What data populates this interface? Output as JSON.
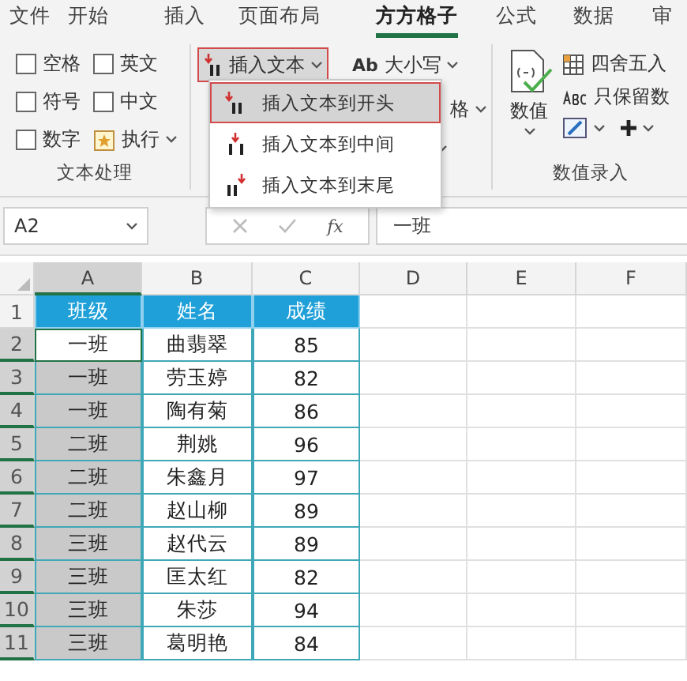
{
  "ribbon_tabs": [
    {
      "label": "文件",
      "selected": false
    },
    {
      "label": "开始",
      "selected": false
    },
    {
      "label": "插入",
      "selected": false
    },
    {
      "label": "页面布局",
      "selected": false
    },
    {
      "label": "方方格子",
      "selected": true
    },
    {
      "label": "公式",
      "selected": false
    },
    {
      "label": "数据",
      "selected": false
    },
    {
      "label": "审",
      "selected": false
    }
  ],
  "text_group": {
    "checkboxes": [
      {
        "label": "空格",
        "checked": false
      },
      {
        "label": "英文",
        "checked": false
      },
      {
        "label": "符号",
        "checked": false
      },
      {
        "label": "中文",
        "checked": false
      },
      {
        "label": "数字",
        "checked": false
      }
    ],
    "execute_button": "执行",
    "label": "文本处理"
  },
  "insert_group": {
    "insert_text_button": {
      "label": "插入文本",
      "expanded": true
    },
    "case_button": {
      "icon_text": "Ab",
      "label": "大小写"
    },
    "partial_button": "格"
  },
  "number_group": {
    "number_button": "数值",
    "round_button": "四舍五入",
    "keep_button": "只保留数",
    "label": "数值录入"
  },
  "insert_menu": {
    "items": [
      {
        "label": "插入文本到开头",
        "selected": true
      },
      {
        "label": "插入文本到中间",
        "selected": false
      },
      {
        "label": "插入文本到末尾",
        "selected": false
      }
    ]
  },
  "formula_bar": {
    "name_box": "A2",
    "fx": "fx",
    "value": "一班"
  },
  "sheet": {
    "columns": [
      {
        "label": "A",
        "selected": true
      },
      {
        "label": "B",
        "selected": false
      },
      {
        "label": "C",
        "selected": false
      },
      {
        "label": "D",
        "selected": false
      },
      {
        "label": "E",
        "selected": false
      },
      {
        "label": "F",
        "selected": false
      }
    ],
    "rows": [
      {
        "number": "1",
        "kind": "header",
        "selected": false,
        "active": false,
        "cells": [
          "班级",
          "姓名",
          "成绩"
        ]
      },
      {
        "number": "2",
        "kind": "data",
        "selected": true,
        "active": true,
        "cells": [
          "一班",
          "曲翡翠",
          "85"
        ]
      },
      {
        "number": "3",
        "kind": "data",
        "selected": true,
        "active": false,
        "cells": [
          "一班",
          "劳玉婷",
          "82"
        ]
      },
      {
        "number": "4",
        "kind": "data",
        "selected": true,
        "active": false,
        "cells": [
          "一班",
          "陶有菊",
          "86"
        ]
      },
      {
        "number": "5",
        "kind": "data",
        "selected": true,
        "active": false,
        "cells": [
          "二班",
          "荆姚",
          "96"
        ]
      },
      {
        "number": "6",
        "kind": "data",
        "selected": true,
        "active": false,
        "cells": [
          "二班",
          "朱鑫月",
          "97"
        ]
      },
      {
        "number": "7",
        "kind": "data",
        "selected": true,
        "active": false,
        "cells": [
          "二班",
          "赵山柳",
          "89"
        ]
      },
      {
        "number": "8",
        "kind": "data",
        "selected": true,
        "active": false,
        "cells": [
          "三班",
          "赵代云",
          "89"
        ]
      },
      {
        "number": "9",
        "kind": "data",
        "selected": true,
        "active": false,
        "cells": [
          "三班",
          "匡太红",
          "82"
        ]
      },
      {
        "number": "10",
        "kind": "data",
        "selected": true,
        "active": false,
        "cells": [
          "三班",
          "朱莎",
          "94"
        ]
      },
      {
        "number": "11",
        "kind": "data",
        "selected": true,
        "active": false,
        "cells": [
          "三班",
          "葛明艳",
          "84"
        ]
      }
    ]
  }
}
